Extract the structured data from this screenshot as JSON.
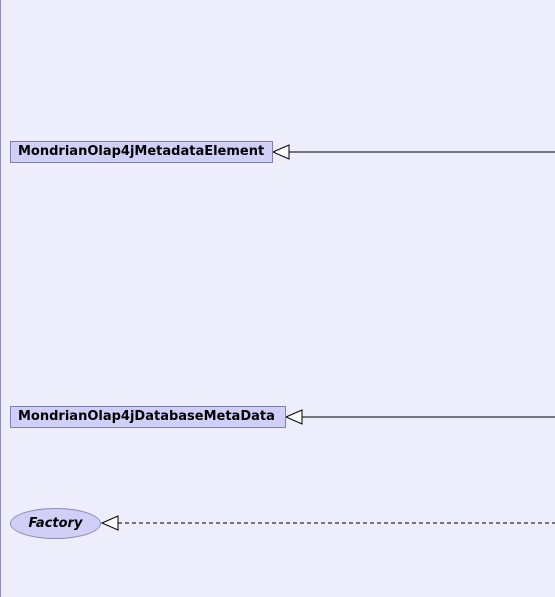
{
  "diagram": {
    "classes": [
      {
        "id": "metadata-element",
        "label": "MondrianOlap4jMetadataElement"
      },
      {
        "id": "database-metadata",
        "label": "MondrianOlap4jDatabaseMetaData"
      }
    ],
    "interfaces": [
      {
        "id": "factory",
        "label": "Factory"
      }
    ],
    "relations": [
      {
        "to": "metadata-element",
        "type": "inheritance",
        "style": "solid"
      },
      {
        "to": "database-metadata",
        "type": "inheritance",
        "style": "solid"
      },
      {
        "to": "factory",
        "type": "realization",
        "style": "dashed"
      }
    ],
    "colors": {
      "background": "#ededfb",
      "node_fill": "#cfcff7",
      "node_border": "#8080b0",
      "edge": "#000000"
    }
  }
}
